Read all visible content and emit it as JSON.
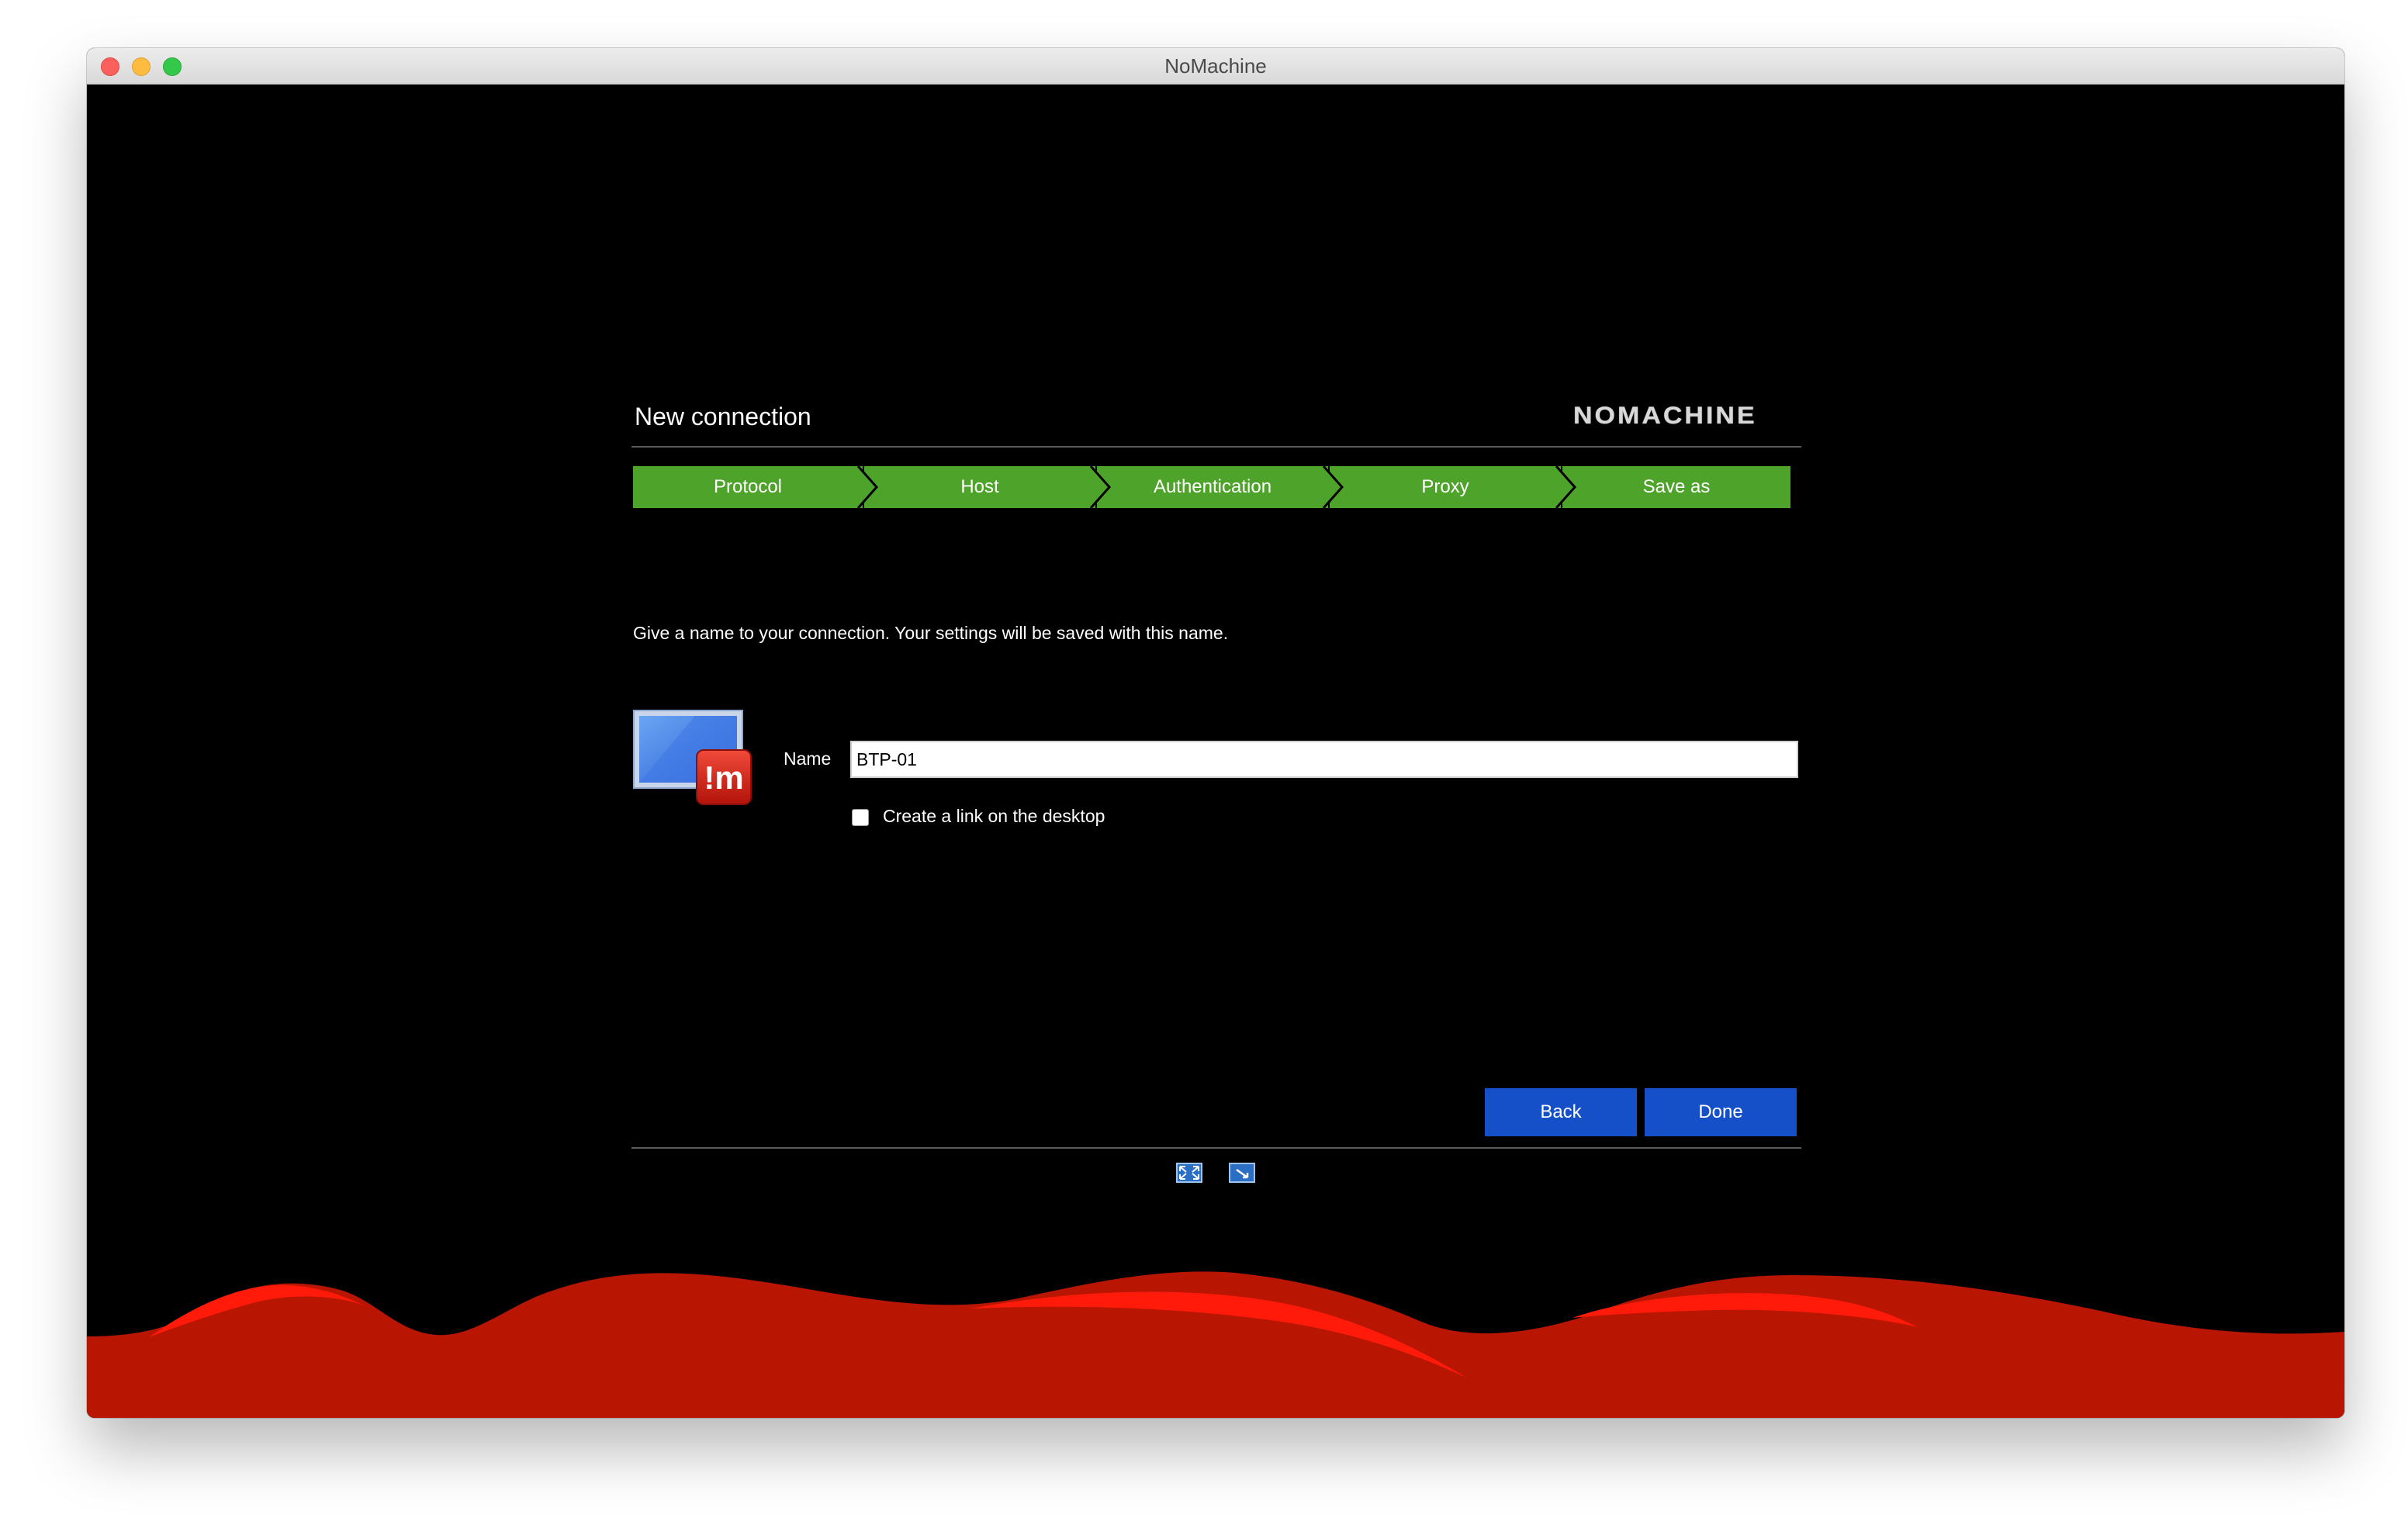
{
  "window": {
    "title": "NoMachine"
  },
  "header": {
    "title": "New connection",
    "logo": "NOMACHINE"
  },
  "steps": [
    {
      "label": "Protocol"
    },
    {
      "label": "Host"
    },
    {
      "label": "Authentication"
    },
    {
      "label": "Proxy"
    },
    {
      "label": "Save as"
    }
  ],
  "form": {
    "instruction": "Give a name to your connection. Your settings will be saved with this name.",
    "name_label": "Name",
    "name_value": "BTP-01",
    "checkbox_label": "Create a link on the desktop",
    "checkbox_checked": false
  },
  "buttons": {
    "back": "Back",
    "done": "Done"
  },
  "icons": {
    "connection": "connection-monitor-icon",
    "fullscreen": "fullscreen-icon",
    "window": "window-mode-icon"
  },
  "colors": {
    "step_green": "#4ea42a",
    "button_blue": "#1650c8",
    "wave_red": "#b81502",
    "wave_highlight": "#ff1a0a"
  }
}
